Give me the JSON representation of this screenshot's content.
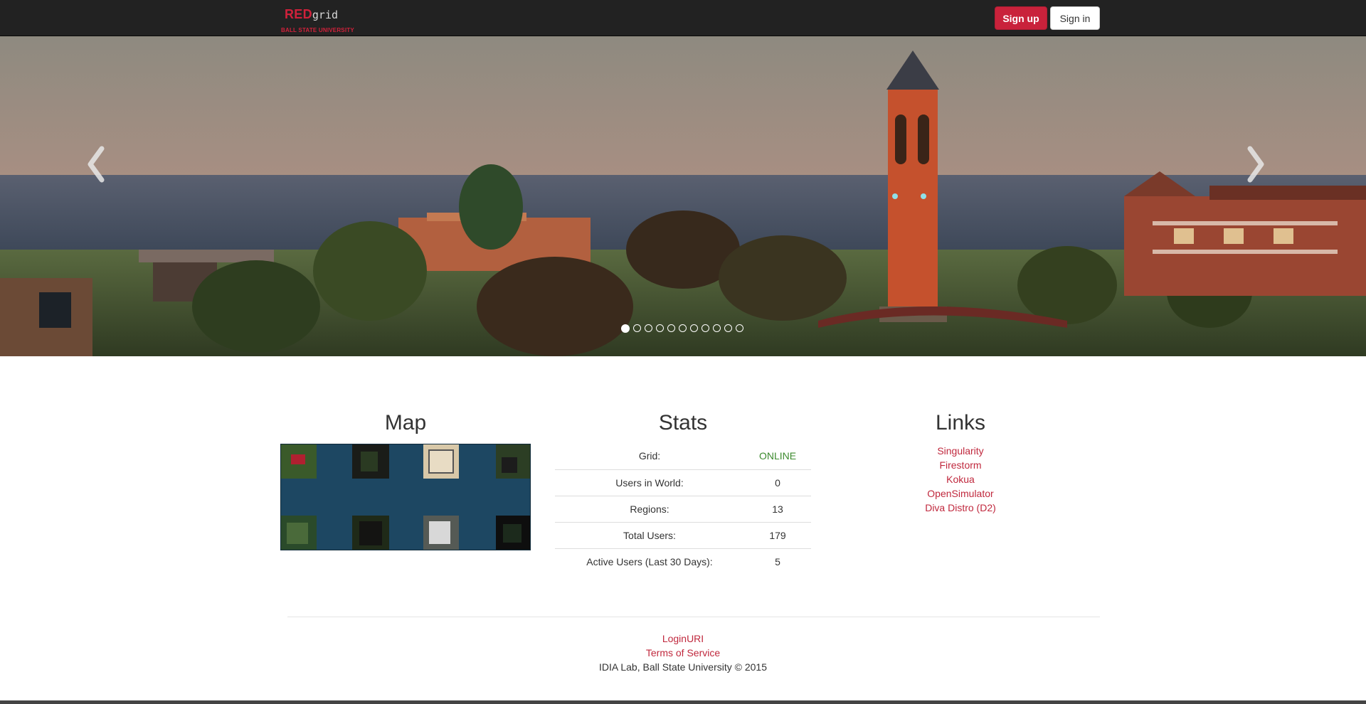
{
  "navbar": {
    "brand_red": "RED",
    "brand_grid": "grid",
    "brand_sub": "BALL STATE UNIVERSITY",
    "signup_label": "Sign up",
    "signin_label": "Sign in",
    "accent_color": "#c9223b",
    "background_color": "#222222"
  },
  "carousel": {
    "prev_icon": "chevron-left-icon",
    "next_icon": "chevron-right-icon",
    "slide_count": 11,
    "active_slide": 1
  },
  "map": {
    "title": "Map"
  },
  "stats": {
    "title": "Stats",
    "rows": [
      {
        "label": "Grid:",
        "value": "ONLINE"
      },
      {
        "label": "Users in World:",
        "value": "0"
      },
      {
        "label": "Regions:",
        "value": "13"
      },
      {
        "label": "Total Users:",
        "value": "179"
      },
      {
        "label": "Active Users (Last 30 Days):",
        "value": "5"
      }
    ],
    "online_color": "#3c8a2e"
  },
  "links": {
    "title": "Links",
    "items": [
      "Singularity",
      "Firestorm",
      "Kokua",
      "OpenSimulator",
      "Diva Distro (D2)"
    ],
    "link_color": "#c0283d"
  },
  "footer": {
    "login_uri": "LoginURI",
    "terms": "Terms of Service",
    "copyright": "IDIA Lab, Ball State University © 2015"
  }
}
